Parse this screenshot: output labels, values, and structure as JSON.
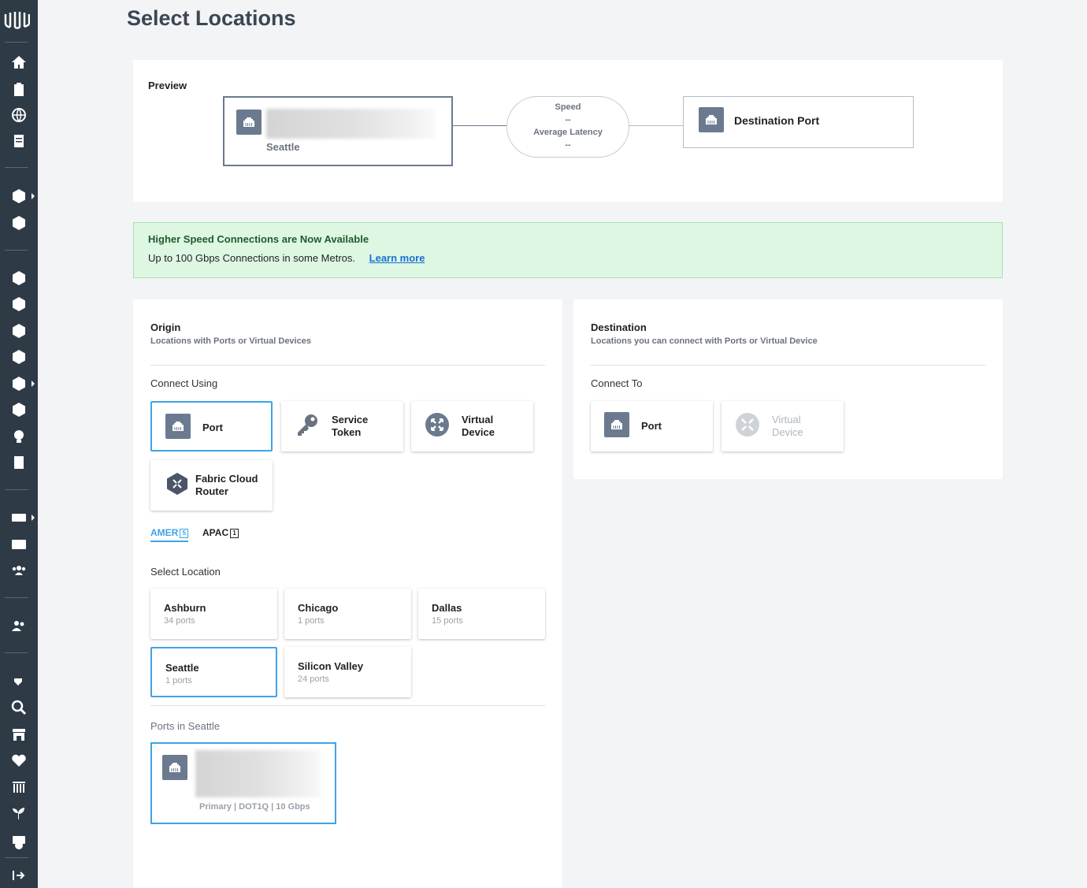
{
  "page": {
    "title": "Select Locations"
  },
  "preview": {
    "label": "Preview",
    "origin_location": "Seattle",
    "speed_label": "Speed",
    "speed_value": "--",
    "latency_label": "Average Latency",
    "latency_value": "--",
    "destination_label": "Destination Port"
  },
  "banner": {
    "title": "Higher Speed Connections are Now Available",
    "text": "Up to 100 Gbps Connections in some Metros.",
    "link": "Learn more"
  },
  "origin": {
    "title": "Origin",
    "subtitle": "Locations with Ports or Virtual Devices",
    "connect_using_label": "Connect Using",
    "options": [
      {
        "line1": "Port",
        "line2": "",
        "icon": "port-icon",
        "selected": true
      },
      {
        "line1": "Service",
        "line2": "Token",
        "icon": "key-icon",
        "selected": false
      },
      {
        "line1": "Virtual",
        "line2": "Device",
        "icon": "virtual-device-icon",
        "selected": false
      },
      {
        "line1": "Fabric Cloud",
        "line2": "Router",
        "icon": "cloud-router-icon",
        "selected": false
      }
    ],
    "tabs": [
      {
        "label": "AMER",
        "count": "5",
        "active": true
      },
      {
        "label": "APAC",
        "count": "1",
        "active": false
      }
    ],
    "select_location_label": "Select Location",
    "locations": [
      {
        "name": "Ashburn",
        "ports": "34 ports"
      },
      {
        "name": "Chicago",
        "ports": "1 ports"
      },
      {
        "name": "Dallas",
        "ports": "15 ports"
      },
      {
        "name": "Seattle",
        "ports": "1 ports"
      },
      {
        "name": "Silicon Valley",
        "ports": "24 ports"
      }
    ],
    "selected_location": "Seattle",
    "ports_in_label": "Ports in Seattle",
    "port_meta": "Primary | DOT1Q | 10 Gbps"
  },
  "destination": {
    "title": "Destination",
    "subtitle": "Locations you can connect with Ports or Virtual Device",
    "connect_to_label": "Connect To",
    "options": [
      {
        "line1": "Port",
        "line2": "",
        "icon": "port-icon",
        "disabled": false
      },
      {
        "line1": "Virtual",
        "line2": "Device",
        "icon": "virtual-device-icon",
        "disabled": true
      }
    ]
  },
  "colors": {
    "sidebar": "#2f3a47",
    "accent": "#3da4e8",
    "icon_gray": "#6b7a8f",
    "banner_bg": "#ddf7e3",
    "link": "#1b6fd6"
  }
}
